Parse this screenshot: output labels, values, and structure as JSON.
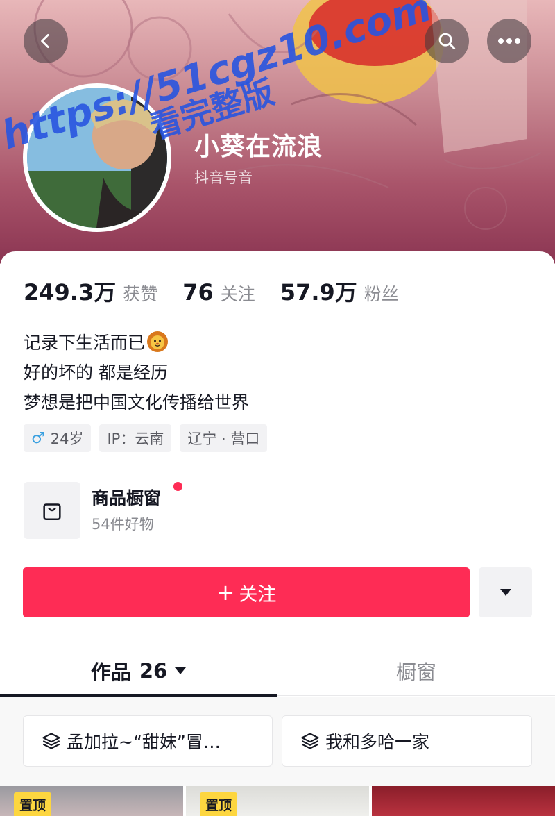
{
  "header": {
    "back_icon": "chevron-left-icon",
    "search_icon": "search-icon",
    "more_icon": "more-horizontal-icon"
  },
  "profile": {
    "nickname": "小葵在流浪",
    "account_id": "抖音号音"
  },
  "stats": [
    {
      "value": "249.3万",
      "label": "获赞"
    },
    {
      "value": "76",
      "label": "关注"
    },
    {
      "value": "57.9万",
      "label": "粉丝"
    }
  ],
  "bio": {
    "line1": "记录下生活而已",
    "line2": "好的坏的 都是经历",
    "line3": "梦想是把中国文化传播给世界"
  },
  "tags": {
    "age": "24岁",
    "ip": "IP：云南",
    "location": "辽宁 · 营口"
  },
  "shop": {
    "title": "商品橱窗",
    "subtitle": "54件好物",
    "icon": "shopping-bag-icon"
  },
  "actions": {
    "follow_plus": "+",
    "follow_label": "关注"
  },
  "tabs": {
    "works_label": "作品",
    "works_count": "26",
    "window_label": "橱窗"
  },
  "collections": [
    {
      "label": "孟加拉~“甜妹”冒…"
    },
    {
      "label": "我和多哈一家"
    }
  ],
  "thumbnails": [
    {
      "badge": "置顶"
    },
    {
      "badge": "置顶"
    },
    {
      "badge": ""
    }
  ],
  "watermark": {
    "url": "https://51cgz10.com",
    "text": "看完整版"
  },
  "colors": {
    "accent": "#fe2c55",
    "pin_badge": "#fdd63f",
    "watermark": "#2855e0"
  }
}
